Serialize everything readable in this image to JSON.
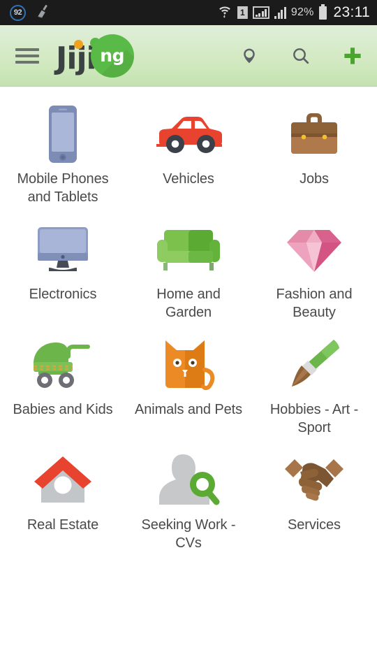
{
  "status_bar": {
    "badge_count": "92",
    "cleaner_icon": "broom-icon",
    "wifi_icon": "wifi-icon",
    "sim_label": "1",
    "battery_percent": "92%",
    "time": "23:11"
  },
  "header": {
    "menu_icon": "hamburger-menu-icon",
    "logo_text": "Jiji",
    "logo_badge": "ng",
    "logo_dot_colors": [
      "#f0a11e",
      "#57b846",
      "#e8402a"
    ],
    "brand_green": "#5aba47",
    "header_bg": "#cfe8bd",
    "actions": [
      {
        "name": "location-icon",
        "label": "Location"
      },
      {
        "name": "search-icon",
        "label": "Search"
      },
      {
        "name": "add-icon",
        "label": "Post Ad"
      }
    ]
  },
  "categories": [
    {
      "label": "Mobile Phones and Tablets",
      "icon": "smartphone-icon"
    },
    {
      "label": "Vehicles",
      "icon": "car-icon"
    },
    {
      "label": "Jobs",
      "icon": "briefcase-icon"
    },
    {
      "label": "Electronics",
      "icon": "monitor-icon"
    },
    {
      "label": "Home and Garden",
      "icon": "sofa-icon"
    },
    {
      "label": "Fashion and Beauty",
      "icon": "diamond-icon"
    },
    {
      "label": "Babies and Kids",
      "icon": "stroller-icon"
    },
    {
      "label": "Animals and Pets",
      "icon": "cat-icon"
    },
    {
      "label": "Hobbies - Art - Sport",
      "icon": "paintbrush-icon"
    },
    {
      "label": "Real Estate",
      "icon": "house-icon"
    },
    {
      "label": "Seeking Work - CVs",
      "icon": "person-search-icon"
    },
    {
      "label": "Services",
      "icon": "handshake-icon"
    }
  ]
}
